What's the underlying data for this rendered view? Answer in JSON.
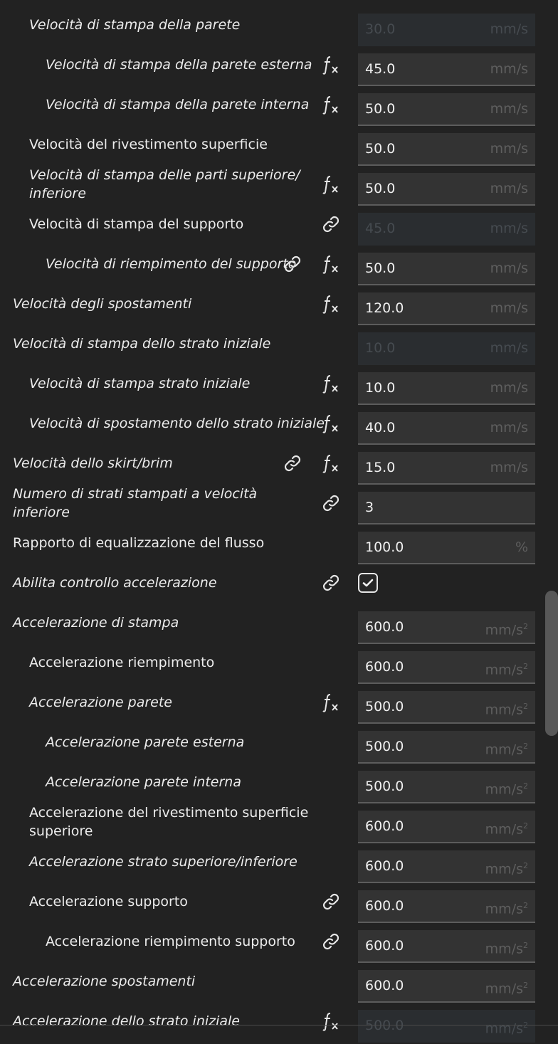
{
  "settings": {
    "rows": [
      {
        "label": "Velocità di stampa della parete",
        "value": "30.0",
        "unit": "mm/s"
      },
      {
        "label": "Velocità di stampa della parete esterna",
        "value": "45.0",
        "unit": "mm/s"
      },
      {
        "label": "Velocità di stampa della parete interna",
        "value": "50.0",
        "unit": "mm/s"
      },
      {
        "label": "Velocità del rivestimento superficie",
        "value": "50.0",
        "unit": "mm/s"
      },
      {
        "label_line1": "Velocità di stampa delle parti superiore/",
        "label_line2": "inferiore",
        "value": "50.0",
        "unit": "mm/s"
      },
      {
        "label": "Velocità di stampa del supporto",
        "value": "45.0",
        "unit": "mm/s"
      },
      {
        "label": "Velocità di riempimento del supporto",
        "value": "50.0",
        "unit": "mm/s"
      },
      {
        "label": "Velocità degli spostamenti",
        "value": "120.0",
        "unit": "mm/s"
      },
      {
        "label": "Velocità di stampa dello strato iniziale",
        "value": "10.0",
        "unit": "mm/s"
      },
      {
        "label": "Velocità di stampa strato iniziale",
        "value": "10.0",
        "unit": "mm/s"
      },
      {
        "label": "Velocità di spostamento dello strato iniziale",
        "value": "40.0",
        "unit": "mm/s"
      },
      {
        "label": "Velocità dello skirt/brim",
        "value": "15.0",
        "unit": "mm/s"
      },
      {
        "label": "Numero di strati stampati a velocità inferiore",
        "value": "3",
        "unit": ""
      },
      {
        "label": "Rapporto di equalizzazione del flusso",
        "value": "100.0",
        "unit": "%"
      },
      {
        "label": "Abilita controllo accelerazione",
        "checked": true
      },
      {
        "label": "Accelerazione di stampa",
        "value": "600.0",
        "unit": "mm/s",
        "unit_sup": "2"
      },
      {
        "label": "Accelerazione riempimento",
        "value": "600.0",
        "unit": "mm/s",
        "unit_sup": "2"
      },
      {
        "label": "Accelerazione parete",
        "value": "500.0",
        "unit": "mm/s",
        "unit_sup": "2"
      },
      {
        "label": "Accelerazione parete esterna",
        "value": "500.0",
        "unit": "mm/s",
        "unit_sup": "2"
      },
      {
        "label": "Accelerazione parete interna",
        "value": "500.0",
        "unit": "mm/s",
        "unit_sup": "2"
      },
      {
        "label_line1": "Accelerazione del rivestimento superficie",
        "label_line2": "superiore",
        "value": "600.0",
        "unit": "mm/s",
        "unit_sup": "2"
      },
      {
        "label": "Accelerazione strato superiore/inferiore",
        "value": "600.0",
        "unit": "mm/s",
        "unit_sup": "2"
      },
      {
        "label": "Accelerazione supporto",
        "value": "600.0",
        "unit": "mm/s",
        "unit_sup": "2"
      },
      {
        "label": "Accelerazione riempimento supporto",
        "value": "600.0",
        "unit": "mm/s",
        "unit_sup": "2"
      },
      {
        "label": "Accelerazione spostamenti",
        "value": "600.0",
        "unit": "mm/s",
        "unit_sup": "2"
      },
      {
        "label": "Accelerazione dello strato iniziale",
        "value": "500.0",
        "unit": "mm/s",
        "unit_sup": "2"
      }
    ]
  },
  "icons": {
    "link": "link-icon",
    "formula": "formula-fx-icon",
    "check": "checkmark-icon"
  },
  "colors": {
    "background": "#222222",
    "field": "#333333",
    "field_disabled": "#2a2d30",
    "text": "#ececec",
    "unit": "#5e5e5e"
  }
}
